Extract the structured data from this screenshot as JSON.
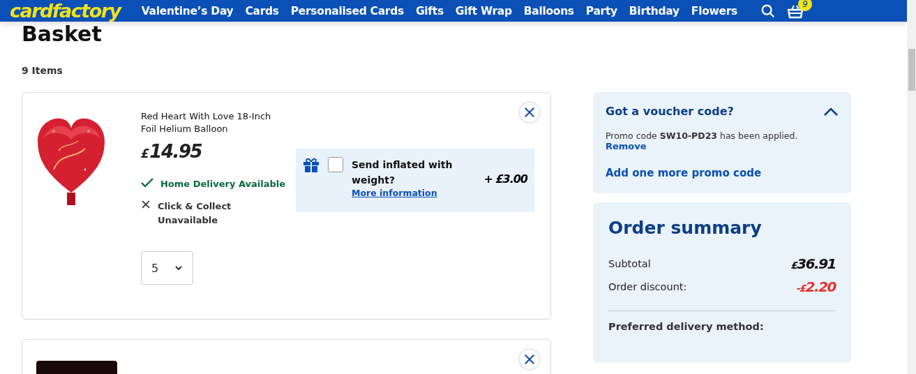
{
  "header": {
    "logo": "cardfactory",
    "nav": [
      "Valentine’s Day",
      "Cards",
      "Personalised Cards",
      "Gifts",
      "Gift Wrap",
      "Balloons",
      "Party",
      "Birthday",
      "Flowers"
    ],
    "basket_count": "9"
  },
  "page": {
    "title": "Basket",
    "count": "9 Items"
  },
  "items": [
    {
      "kind": "full",
      "name": "Red Heart With Love 18-Inch Foil Helium Balloon",
      "currency": "£",
      "price": "14.95",
      "delivery": [
        {
          "label": "Home Delivery Available",
          "available": true
        },
        {
          "label": "Click & Collect Unavailable",
          "available": false
        }
      ],
      "quantity": "5",
      "upsell": {
        "label": "Send inflated with weight?",
        "link": "More information",
        "price": "+ £3.00",
        "checked": false
      }
    },
    {
      "kind": "partial"
    }
  ],
  "voucher": {
    "title": "Got a voucher code?",
    "expanded": true,
    "message": "Promo code **SW10-PD23** has been applied.",
    "remove": "Remove",
    "add": "Add one more promo code"
  },
  "summary": {
    "title": "Order summary",
    "rows": [
      {
        "label": "Subtotal",
        "currency": "£",
        "value": "36.91",
        "kind": "normal"
      },
      {
        "label": "Order discount:",
        "currency": "-£",
        "value": "2.20",
        "kind": "discount"
      }
    ],
    "delivery_label": "Preferred delivery method:"
  }
}
